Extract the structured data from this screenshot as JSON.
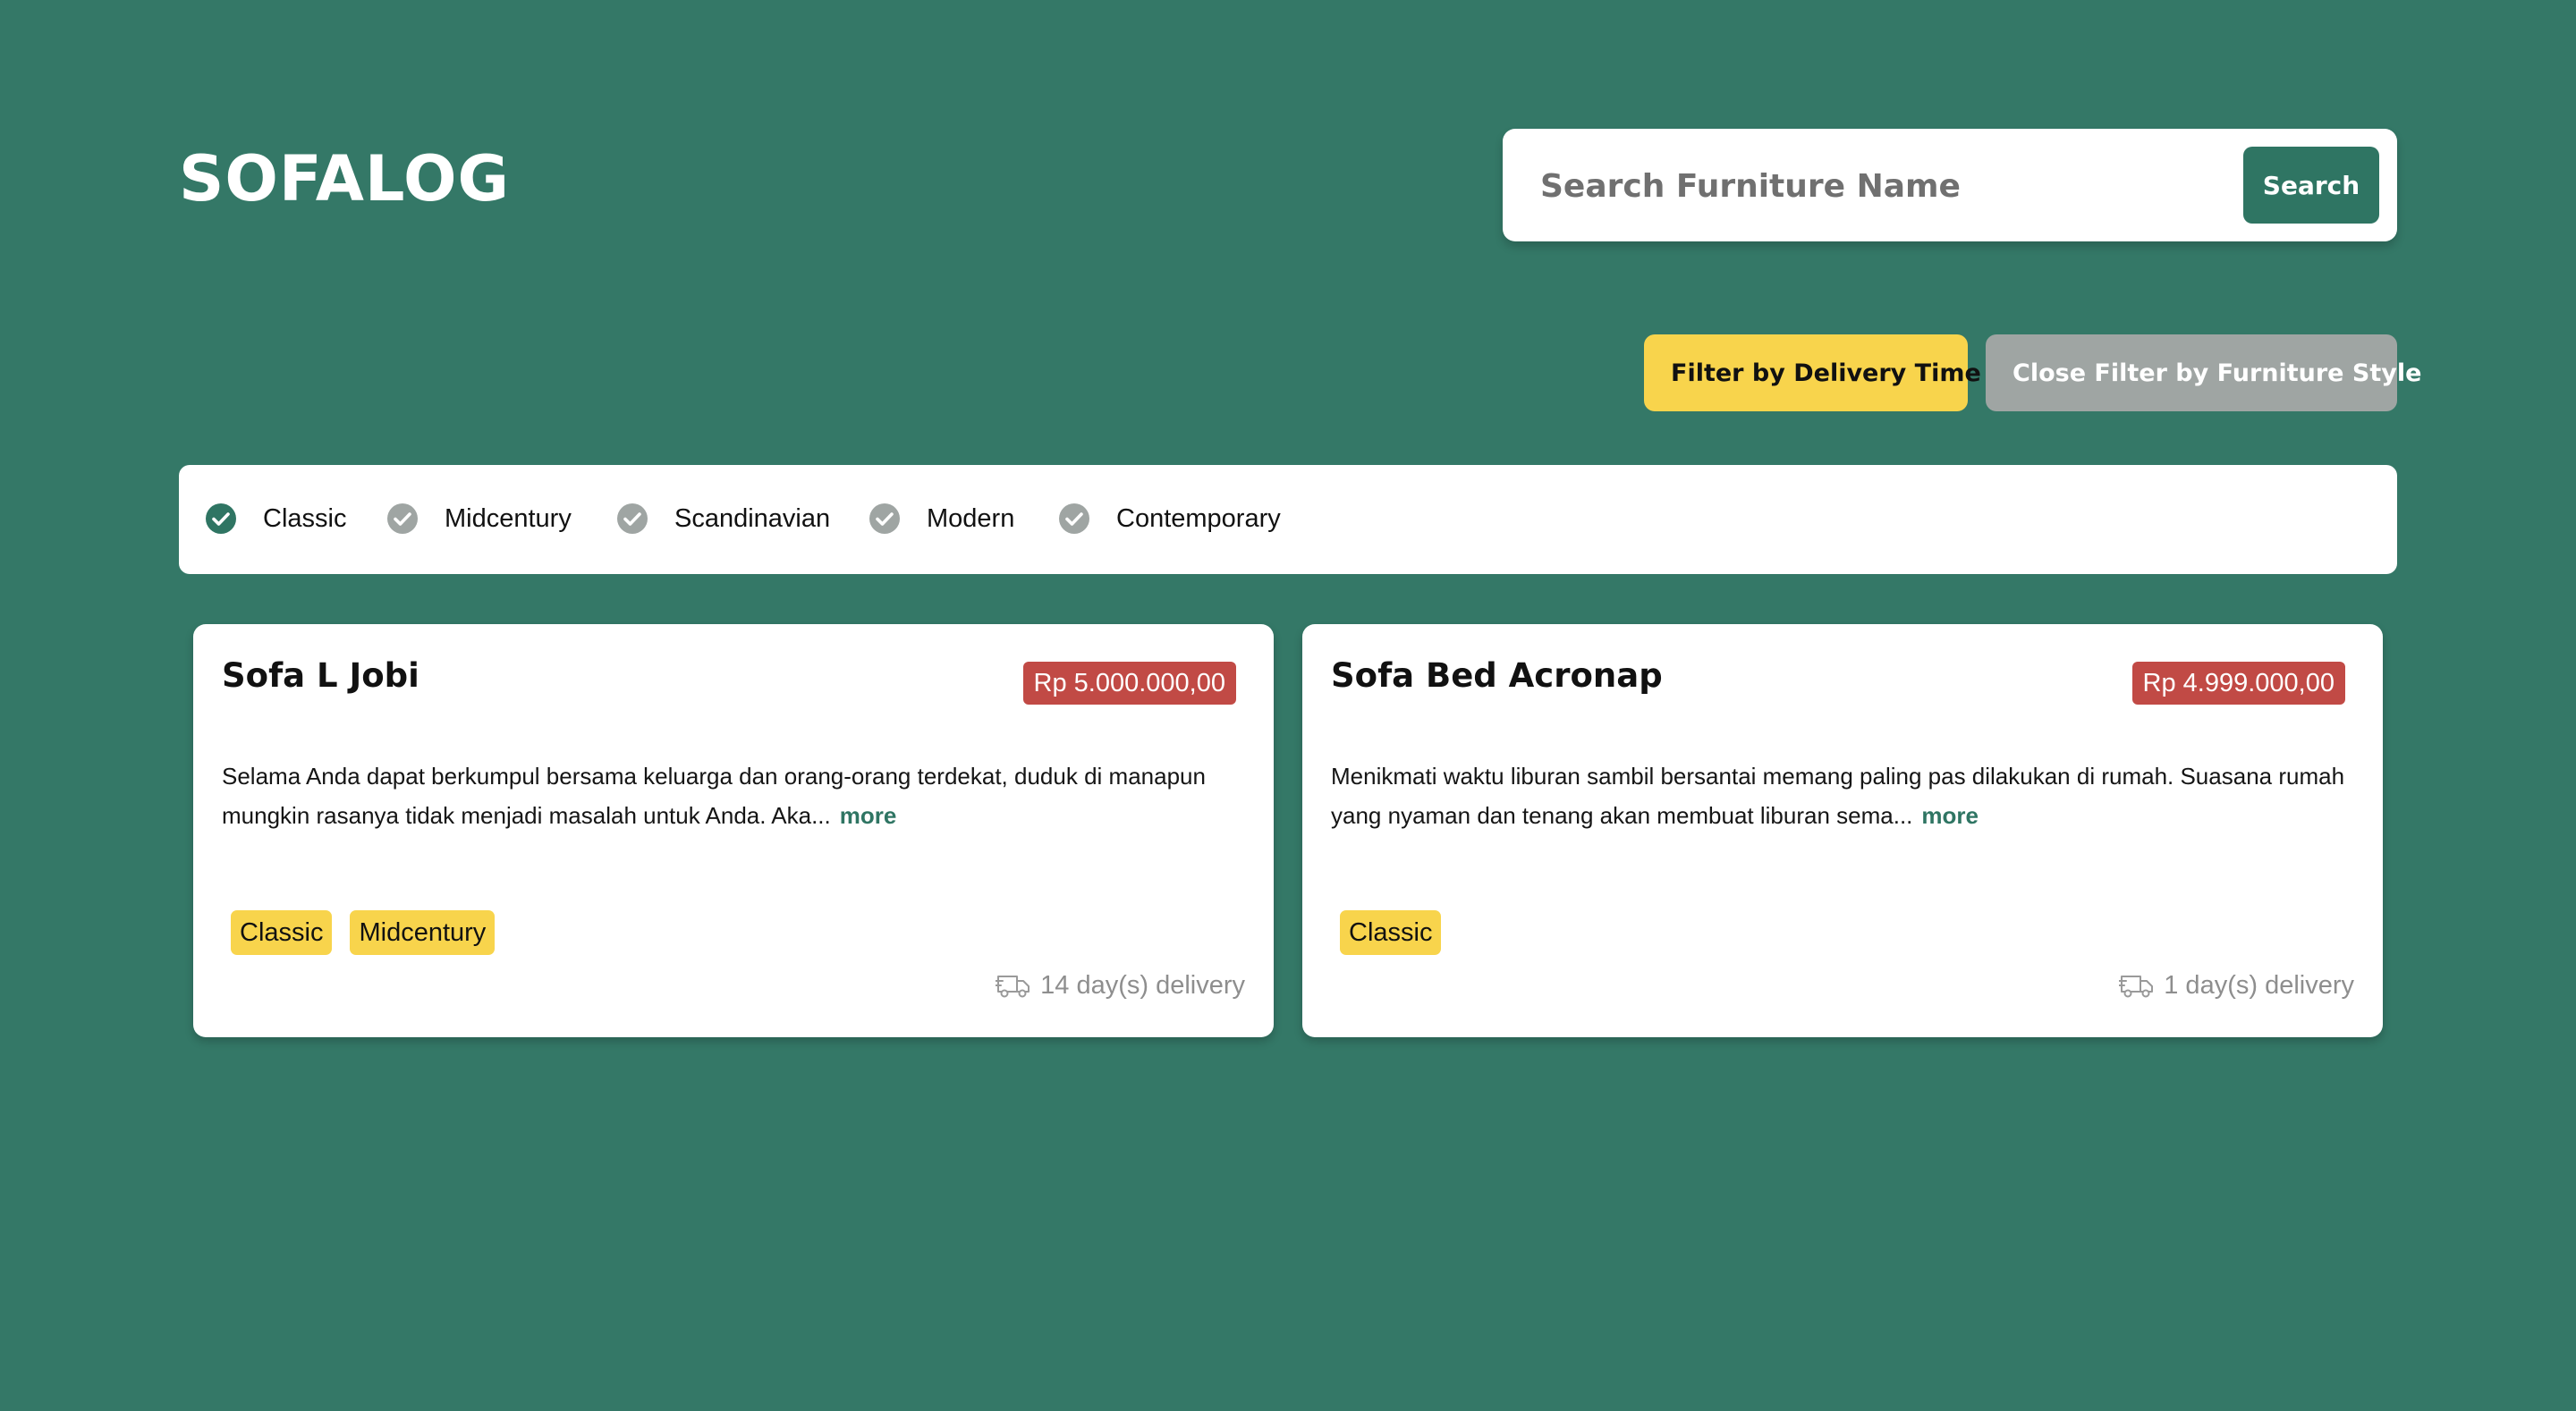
{
  "app": {
    "logo": "SOFALOG"
  },
  "search": {
    "placeholder": "Search Furniture Name",
    "value": "",
    "button_label": "Search"
  },
  "filters": {
    "delivery_button_label": "Filter by Delivery Time",
    "style_button_label": "Close Filter by Furniture Style"
  },
  "style_options": [
    {
      "label": "Classic",
      "checked": true
    },
    {
      "label": "Midcentury",
      "checked": false
    },
    {
      "label": "Scandinavian",
      "checked": false
    },
    {
      "label": "Modern",
      "checked": false
    },
    {
      "label": "Contemporary",
      "checked": false
    }
  ],
  "products": [
    {
      "name": "Sofa L Jobi",
      "price": "Rp 5.000.000,00",
      "description": "Selama Anda dapat berkumpul bersama keluarga dan orang-orang terdekat, duduk di manapun mungkin rasanya tidak menjadi masalah untuk Anda. Aka...",
      "more_label": "more",
      "tags": [
        "Classic",
        "Midcentury"
      ],
      "delivery": "14 day(s) delivery",
      "delivery_icon": "truck-icon"
    },
    {
      "name": "Sofa Bed Acronap",
      "price": "Rp 4.999.000,00",
      "description": "Menikmati waktu liburan sambil bersantai memang paling pas dilakukan di rumah. Suasana rumah yang nyaman dan tenang akan membuat liburan sema...",
      "more_label": "more",
      "tags": [
        "Classic"
      ],
      "delivery": "1 day(s) delivery",
      "delivery_icon": "truck-icon"
    }
  ],
  "colors": {
    "background": "#347867",
    "primary": "#2f7563",
    "accent_yellow": "#f8d44c",
    "price_red": "#c14a45",
    "muted_gray": "#9fa5a3",
    "check_active": "#2f7563",
    "check_inactive": "#9fa5a3"
  }
}
